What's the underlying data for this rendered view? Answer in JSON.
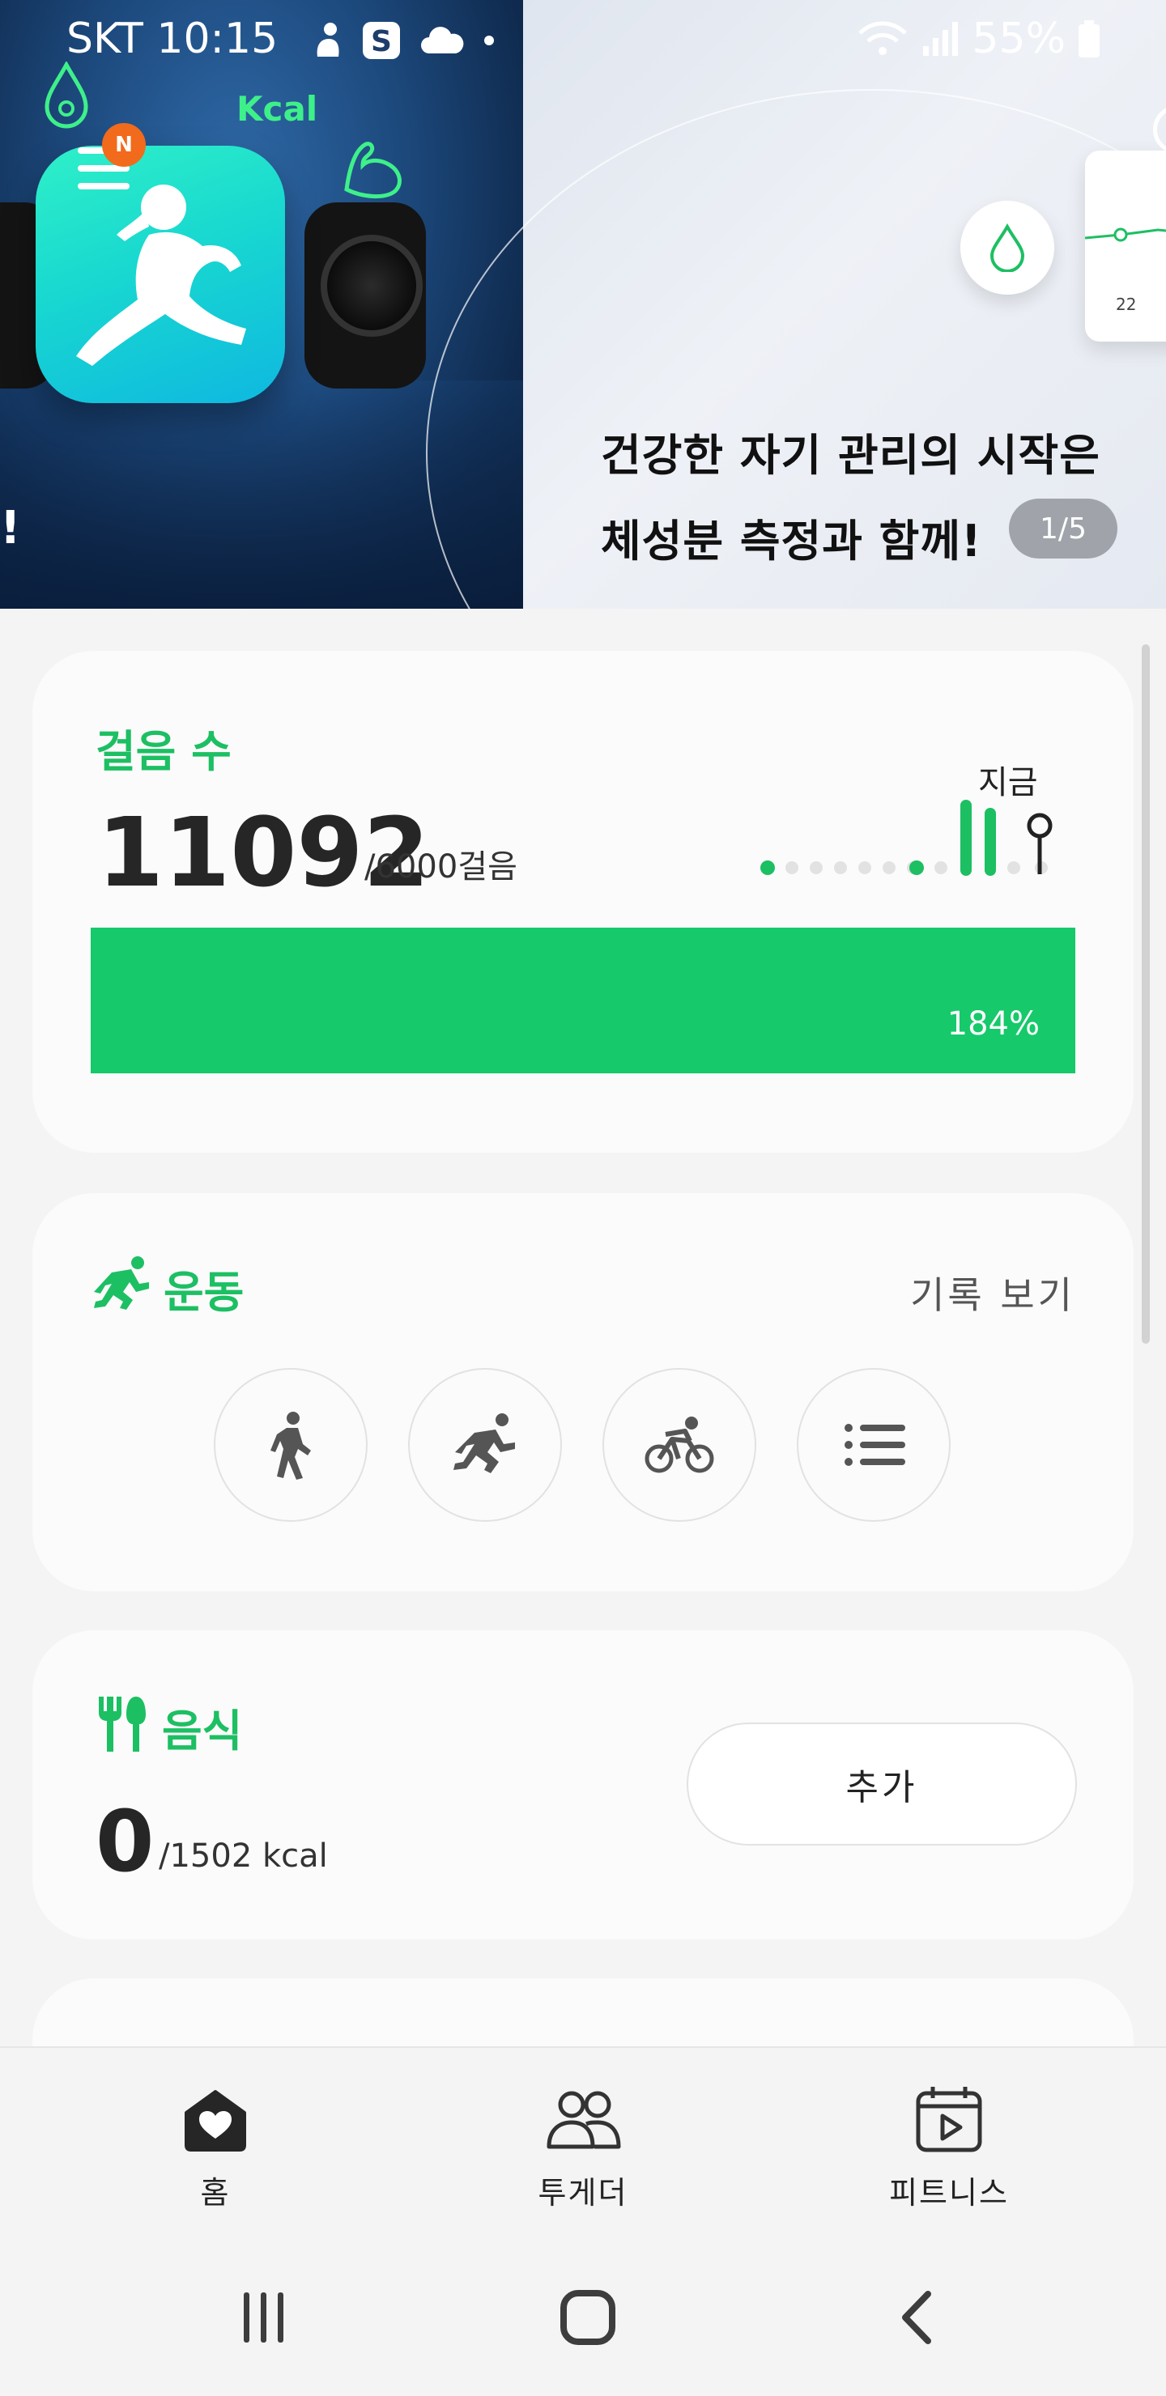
{
  "status_bar": {
    "time": "SKT 10:15",
    "battery": "55%"
  },
  "banner": {
    "kcal_label": "Kcal",
    "menu_badge": "N",
    "left_edge_mark": "!",
    "headline_line1": "건강한 자기 관리의 시작은",
    "headline_line2": "체성분 측정과 함께!",
    "counter": "1/5",
    "mini_chart_label": "22"
  },
  "steps": {
    "title": "걸음 수",
    "value": "11092",
    "goal": "/6000걸음",
    "now_label": "지금",
    "percent_text": "184%",
    "progress": 1.0
  },
  "exercise": {
    "title": "운동",
    "view_records": "기록 보기",
    "buttons": [
      "walking",
      "running",
      "cycling",
      "more-list"
    ]
  },
  "food": {
    "title": "음식",
    "value": "0",
    "goal": "/1502 kcal",
    "add_label": "추가"
  },
  "nav": {
    "home": "홈",
    "together": "투게더",
    "fitness": "피트니스"
  },
  "colors": {
    "accent": "#16c96a",
    "title_green": "#1dbf63",
    "badge_orange": "#f26a1b"
  }
}
